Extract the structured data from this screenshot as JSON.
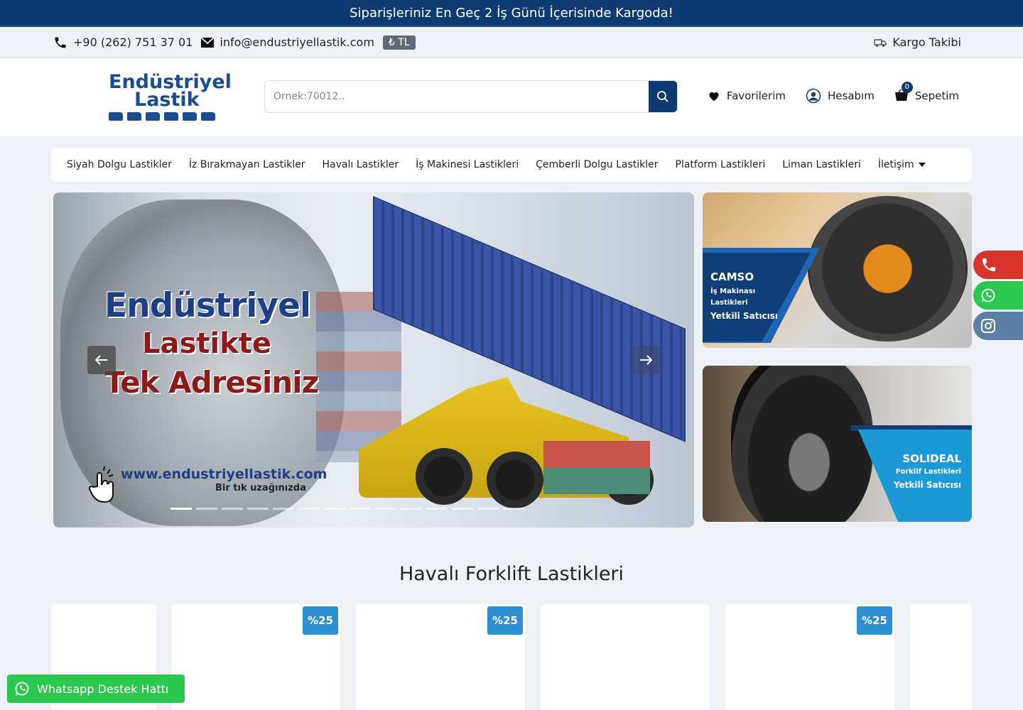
{
  "announcement": "Siparişleriniz En Geç 2 İş Günü İçerisinde Kargoda!",
  "topbar": {
    "phone": "+90 (262) 751 37 01",
    "email": "info@endustriyellastik.com",
    "currency": "₺ TL",
    "tracking": "Kargo Takibi"
  },
  "logo": {
    "line1": "Endüstriyel",
    "line2": "Lastik"
  },
  "search": {
    "placeholder": "Örnek:70012.."
  },
  "actions": {
    "favorites": "Favorilerim",
    "account": "Hesabım",
    "cart": "Sepetim",
    "cart_count": "0"
  },
  "nav": [
    "Siyah Dolgu Lastikler",
    "İz Bırakmayan Lastikler",
    "Havalı Lastikler",
    "İş Makinesi Lastikleri",
    "Çemberli Dolgu Lastikler",
    "Platform Lastikleri",
    "Liman Lastikleri",
    "İletişim"
  ],
  "hero": {
    "line1": "Endüstriyel",
    "line2": "Lastikte",
    "line3": "Tek Adresiniz",
    "url": "www.endustriyellastik.com",
    "tagline": "Bir tık uzağınızda"
  },
  "banner1": {
    "brand": "CAMSO",
    "sub1": "İş Makinası",
    "sub2": "Lastikleri",
    "sub3": "Yetkili Satıcısı"
  },
  "banner2": {
    "brand": "SOLIDEAL",
    "sub1": "Forklif Lastikleri",
    "sub2": "Yetkili Satıcısı"
  },
  "section_title": "Havalı Forklift Lastikleri",
  "badges": [
    "%25",
    "%25",
    "%25"
  ],
  "whatsapp_support": "Whatsapp Destek Hattı",
  "colors": {
    "brand_navy": "#0e3b72",
    "badge_blue": "#2e8fd1",
    "whatsapp_green": "#2cc74f",
    "phone_red": "#d9342b"
  }
}
